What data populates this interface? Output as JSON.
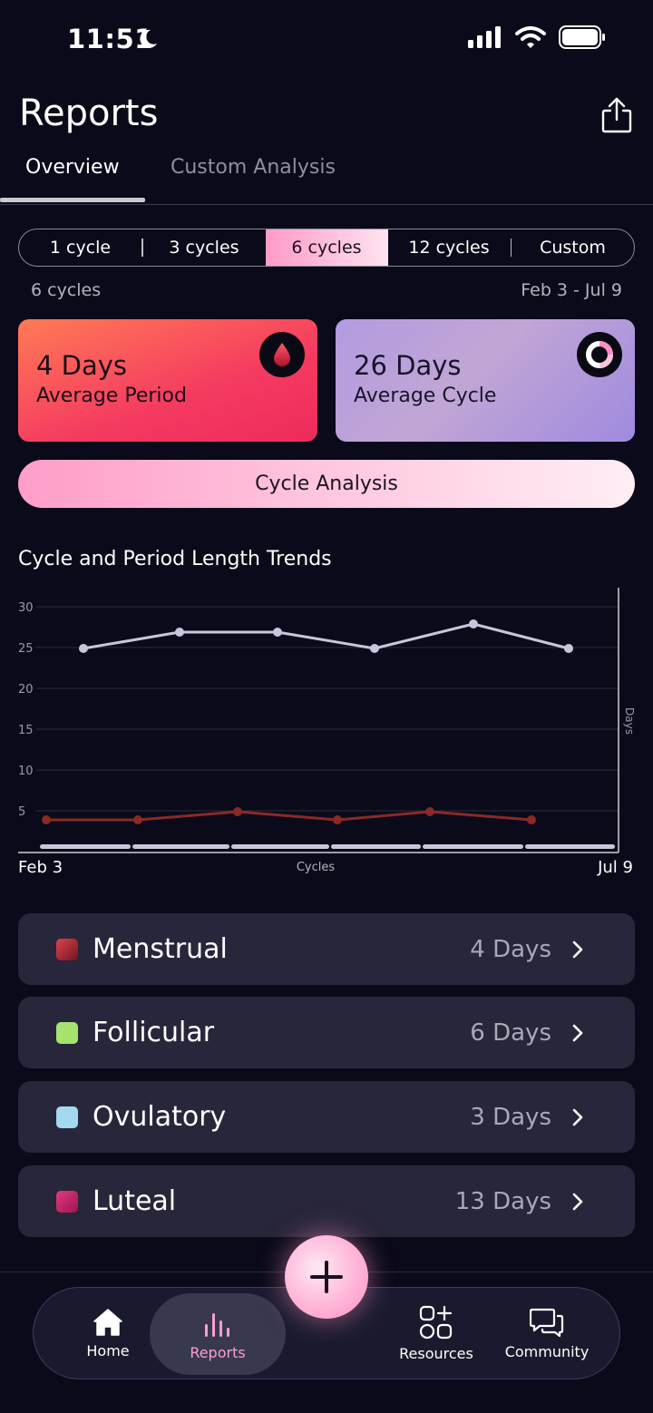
{
  "status": {
    "time": "11:51"
  },
  "header": {
    "title": "Reports"
  },
  "tabs": [
    {
      "label": "Overview"
    },
    {
      "label": "Custom Analysis"
    }
  ],
  "segments": [
    "1 cycle",
    "3 cycles",
    "6 cycles",
    "12 cycles",
    "Custom"
  ],
  "selected_segment": "6 cycles",
  "range": {
    "left": "6 cycles",
    "right": "Feb 3 - Jul 9"
  },
  "cards": {
    "period": {
      "value": "4 Days",
      "label": "Average Period",
      "color": "#f53b60"
    },
    "cycle": {
      "value": "26 Days",
      "label": "Average Cycle",
      "color": "#b39be0"
    }
  },
  "analysis_button": "Cycle Analysis",
  "chart_title": "Cycle and Period Length Trends",
  "chart_data": {
    "type": "line",
    "title": "Cycle and Period Length Trends",
    "xlabel": "Cycles",
    "ylabel": "Days",
    "x_start_label": "Feb 3",
    "x_end_label": "Jul 9",
    "yticks": [
      5,
      10,
      15,
      20,
      25,
      30
    ],
    "ylim": [
      0,
      30
    ],
    "series": [
      {
        "values": [
          25,
          27,
          27,
          25,
          28,
          25
        ],
        "color": "#c8c6dc"
      },
      {
        "values": [
          4,
          4,
          5,
          4,
          5,
          4
        ],
        "color": "#8a2a24"
      }
    ]
  },
  "phases": [
    {
      "name": "Menstrual",
      "days": "4 Days",
      "color": "#9a2832"
    },
    {
      "name": "Follicular",
      "days": "6 Days",
      "color": "#a6e36f"
    },
    {
      "name": "Ovulatory",
      "days": "3 Days",
      "color": "#a3d8ee"
    },
    {
      "name": "Luteal",
      "days": "13 Days",
      "color": "#c8256a"
    }
  ],
  "nav": [
    {
      "label": "Home"
    },
    {
      "label": "Reports"
    },
    {
      "label": "Resources"
    },
    {
      "label": "Community"
    }
  ]
}
